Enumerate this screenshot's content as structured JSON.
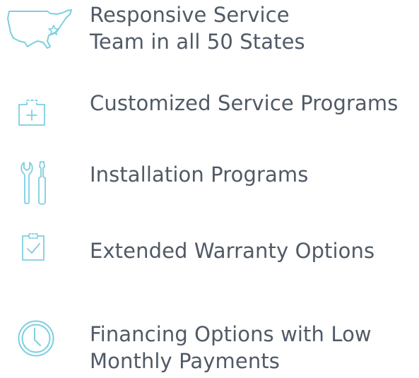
{
  "colors": {
    "icon": "#7ccfe0",
    "text": "#505a66",
    "background": "#ffffff"
  },
  "features": [
    {
      "icon": "usa-map-star-icon",
      "lines": [
        "Responsive Service",
        "Team in all 50 States"
      ]
    },
    {
      "icon": "medical-kit-icon",
      "lines": [
        "Customized Service Programs"
      ]
    },
    {
      "icon": "wrench-screwdriver-icon",
      "lines": [
        "Installation Programs"
      ]
    },
    {
      "icon": "clipboard-check-icon",
      "lines": [
        "Extended Warranty Options"
      ]
    },
    {
      "icon": "clock-icon",
      "lines": [
        "Financing Options with Low",
        "Monthly Payments"
      ]
    }
  ]
}
